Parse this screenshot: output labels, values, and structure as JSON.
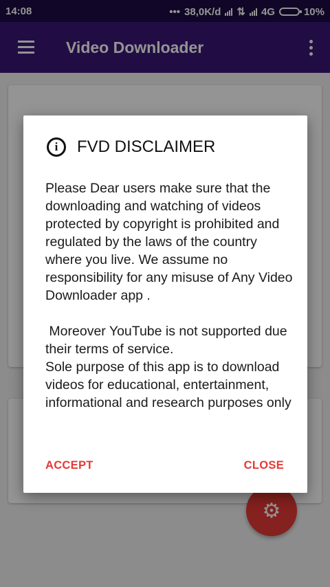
{
  "status_bar": {
    "time": "14:08",
    "network_speed": "38,0K/d",
    "network_type": "4G",
    "battery": "10%"
  },
  "app_bar": {
    "title": "Video Downloader",
    "menu_icon": "hamburger-icon",
    "overflow_icon": "more-vert-icon",
    "color": "#3a1875"
  },
  "fab": {
    "icon": "gear-icon",
    "color": "#e53935"
  },
  "dialog": {
    "icon": "info-icon",
    "title": "FVD DISCLAIMER",
    "body": "Please Dear users make sure that the downloading and watching of videos protected by copyright is prohibited and regulated by the laws of the country where you live. We assume no responsibility for any misuse of Any Video Downloader app .\n\n Moreover YouTube is not supported due their terms of service.\nSole purpose of this app is to download videos for educational, entertainment, informational and research purposes only",
    "accept_label": "ACCEPT",
    "close_label": "CLOSE",
    "accent": "#e53935"
  }
}
